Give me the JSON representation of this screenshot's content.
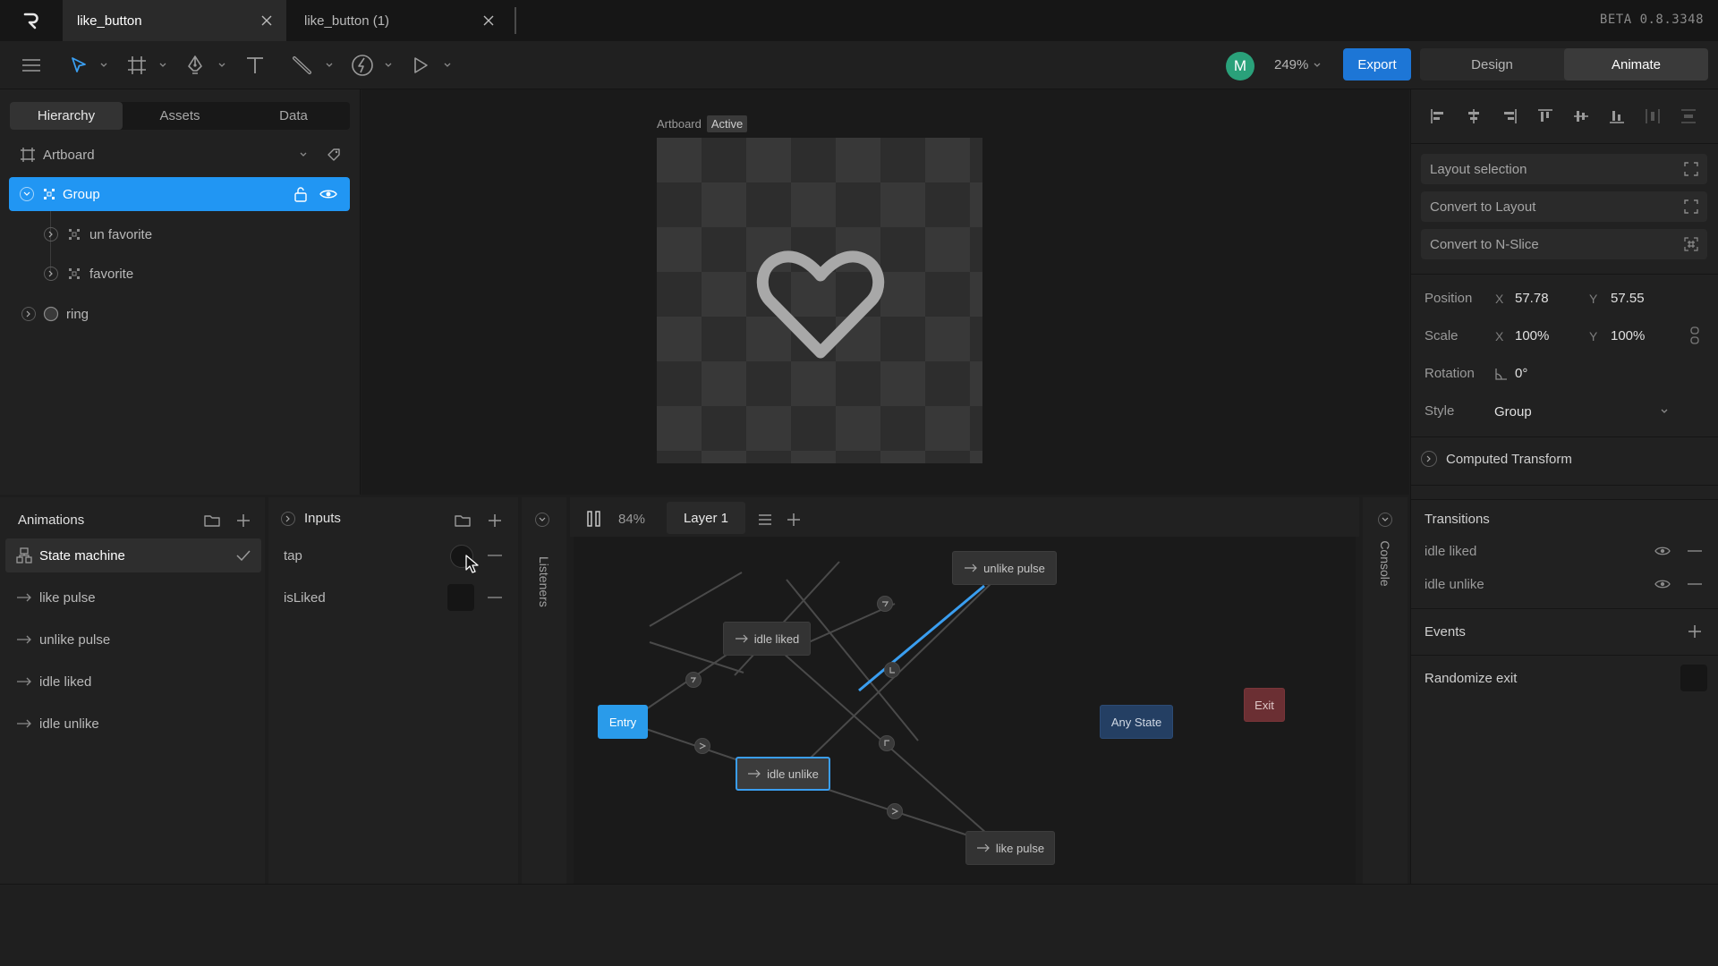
{
  "app": {
    "version": "BETA 0.8.3348",
    "logo": "rive-logo-icon"
  },
  "tabs": [
    {
      "label": "like_button",
      "active": true
    },
    {
      "label": "like_button (1)",
      "active": false
    }
  ],
  "toolbar": {
    "avatar_initial": "M",
    "zoom": "249%",
    "export_label": "Export",
    "modes": [
      "Design",
      "Animate"
    ],
    "active_mode": "Animate",
    "accent": "#1d76d6"
  },
  "left_panel": {
    "tabs": [
      "Hierarchy",
      "Assets",
      "Data"
    ],
    "artboard_label": "Artboard",
    "tree": [
      {
        "label": "Group",
        "selected": true
      },
      {
        "label": "un favorite"
      },
      {
        "label": "favorite"
      },
      {
        "label": "ring"
      }
    ]
  },
  "canvas": {
    "artboard_label": "Artboard",
    "status": "Active",
    "content_icon": "heart-outline-icon"
  },
  "right_panel": {
    "layout_selection": "Layout selection",
    "convert_layout": "Convert to Layout",
    "convert_nslice": "Convert to N-Slice",
    "position": {
      "label": "Position",
      "x_axis": "X",
      "x": "57.78",
      "y_axis": "Y",
      "y": "57.55"
    },
    "scale": {
      "label": "Scale",
      "x_axis": "X",
      "x": "100%",
      "y_axis": "Y",
      "y": "100%"
    },
    "rotation": {
      "label": "Rotation",
      "value": "0°"
    },
    "style": {
      "label": "Style",
      "value": "Group"
    },
    "computed_transform": "Computed Transform",
    "transitions": {
      "title": "Transitions",
      "items": [
        "idle liked",
        "idle unlike"
      ]
    },
    "events": "Events",
    "randomize_exit": "Randomize exit"
  },
  "animations": {
    "title": "Animations",
    "items": [
      {
        "label": "State machine",
        "type": "state-machine",
        "selected": true
      },
      {
        "label": "like pulse"
      },
      {
        "label": "unlike pulse"
      },
      {
        "label": "idle liked"
      },
      {
        "label": "idle unlike"
      }
    ]
  },
  "inputs": {
    "title": "Inputs",
    "items": [
      {
        "label": "tap",
        "type": "trigger"
      },
      {
        "label": "isLiked",
        "type": "boolean"
      }
    ]
  },
  "side_labels": {
    "listeners": "Listeners",
    "console": "Console"
  },
  "state_machine": {
    "zoom": "84%",
    "layer": "Layer 1",
    "nodes": {
      "entry": "Entry",
      "idle_liked": "idle liked",
      "idle_unlike": "idle unlike",
      "unlike_pulse": "unlike pulse",
      "like_pulse": "like pulse",
      "any_state": "Any State",
      "exit": "Exit"
    },
    "colors": {
      "entry": "#2a9bea",
      "any_state": "#243f63",
      "exit": "#6b2f33",
      "active_transition": "#3a9ef0"
    }
  }
}
